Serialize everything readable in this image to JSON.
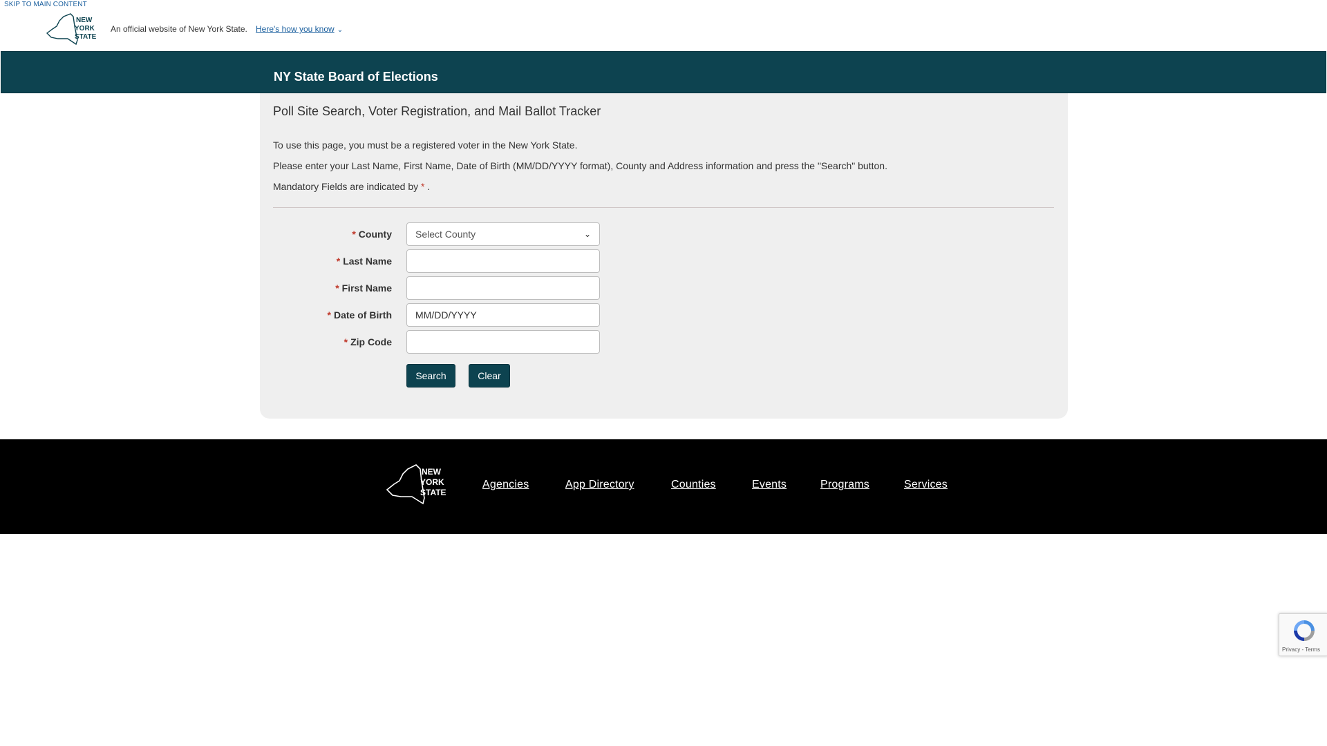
{
  "gov_header": {
    "skip_link": "SKIP TO MAIN CONTENT",
    "logo_text": [
      "NEW",
      "YORK",
      "STATE"
    ],
    "official_text": "An official website of New York State.",
    "how_you_know": "Here's how you know"
  },
  "agency": {
    "title": "NY State Board of Elections"
  },
  "panel": {
    "title": "Poll Site Search, Voter Registration, and Mail Ballot Tracker",
    "intro_1": "To use this page, you must be a registered voter in the New York State.",
    "intro_2": "Please enter your Last Name, First Name, Date of Birth (MM/DD/YYYY format), County and Address information and press the \"Search\" button.",
    "intro_3_prefix": "Mandatory Fields are indicated by ",
    "required_marker": "*",
    "intro_3_suffix": " ."
  },
  "form": {
    "county": {
      "label": "County",
      "selected": "Select County"
    },
    "last_name": {
      "label": "Last Name",
      "value": ""
    },
    "first_name": {
      "label": "First Name",
      "value": ""
    },
    "dob": {
      "label": "Date of Birth",
      "value": "MM/DD/YYYY"
    },
    "zip": {
      "label": "Zip Code",
      "value": ""
    },
    "search_label": "Search",
    "clear_label": "Clear"
  },
  "footer": {
    "logo_text": [
      "NEW",
      "YORK",
      "STATE"
    ],
    "links": [
      "Agencies",
      "App Directory",
      "Counties",
      "Events",
      "Programs",
      "Services"
    ]
  },
  "recaptcha": {
    "text": "Privacy - Terms"
  },
  "colors": {
    "brand_teal": "#0d4350",
    "required_red": "#c0392b",
    "link_blue": "#1a5f9e",
    "panel_bg": "#efefef",
    "footer_bg": "#000000"
  }
}
